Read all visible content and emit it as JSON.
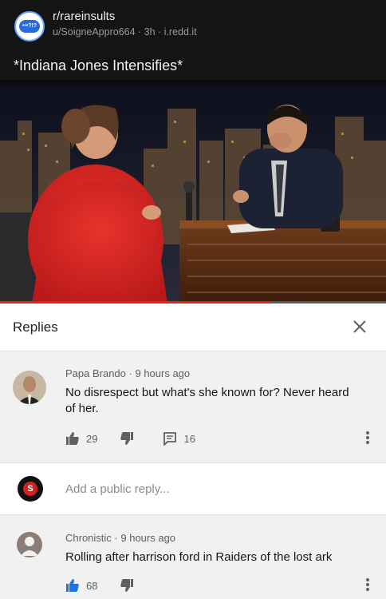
{
  "post": {
    "subreddit": "r/rareinsults",
    "meta": "u/SoigneAppro664 · 3h · i.redd.it",
    "title": "*Indiana Jones Intensifies*",
    "subreddit_icon_text": "•••?!?"
  },
  "video": {
    "progress_fraction": 0.7
  },
  "replies_panel": {
    "title": "Replies",
    "reply_placeholder": "Add a public reply...",
    "reply_avatar_letter": "S"
  },
  "comments": [
    {
      "author": "Papa Brando",
      "time": "9 hours ago",
      "text": "No disrespect but what's she known for? Never heard of her.",
      "likes": "29",
      "replies": "16"
    },
    {
      "author": "Chronistic",
      "time": "9 hours ago",
      "text": "Rolling after harrison ford in Raiders of the lost ark",
      "likes": "68"
    }
  ],
  "colors": {
    "accent_red": "#e62117",
    "like_blue": "#1a73e8",
    "icon_gray": "#606060"
  }
}
